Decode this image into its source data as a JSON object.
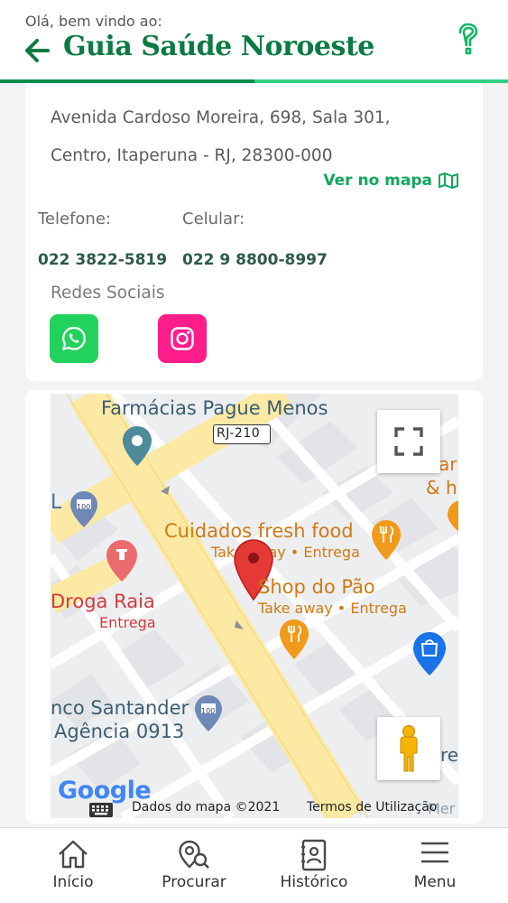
{
  "header": {
    "greeting": "Olá, bem vindo ao:",
    "title": "Guia Saúde Noroeste"
  },
  "details": {
    "address_line1": "Avenida Cardoso Moreira, 698, Sala 301,",
    "address_line2": "Centro, Itaperuna - RJ, 28300-000",
    "map_link": "Ver no mapa",
    "phone_label": "Telefone:",
    "phone_value": "022 3822-5819",
    "mobile_label": "Celular:",
    "mobile_value": "022 9 8800-8997",
    "social_label": "Redes Sociais",
    "social": [
      {
        "name": "whatsapp",
        "color": "#22d25d"
      },
      {
        "name": "instagram",
        "color": "#ff1d8c"
      }
    ]
  },
  "map": {
    "labels": {
      "pharmacy": "Farmácias Pague Menos",
      "road": "RJ-210",
      "food": "Cuidados fresh food",
      "food_sub": "Take away • Entrega",
      "bakery": "Shop do Pão",
      "bakery_sub": "Take away • Entrega",
      "drugstore": "Droga Raia",
      "drugstore_sub": "Entrega",
      "bank1": "nco Santander",
      "bank2": "Agência 0913",
      "edge_right": "ar",
      "edge_right2": "& h",
      "edge_re": "re",
      "edge_mer": "Mer",
      "edge_l": "L",
      "bank_badge": "100",
      "logo": "Google"
    },
    "attribution": "Dados do mapa ©2021",
    "terms": "Termos de Utilização"
  },
  "nav": {
    "items": [
      {
        "label": "Início"
      },
      {
        "label": "Procurar"
      },
      {
        "label": "Histórico"
      },
      {
        "label": "Menu"
      }
    ]
  }
}
